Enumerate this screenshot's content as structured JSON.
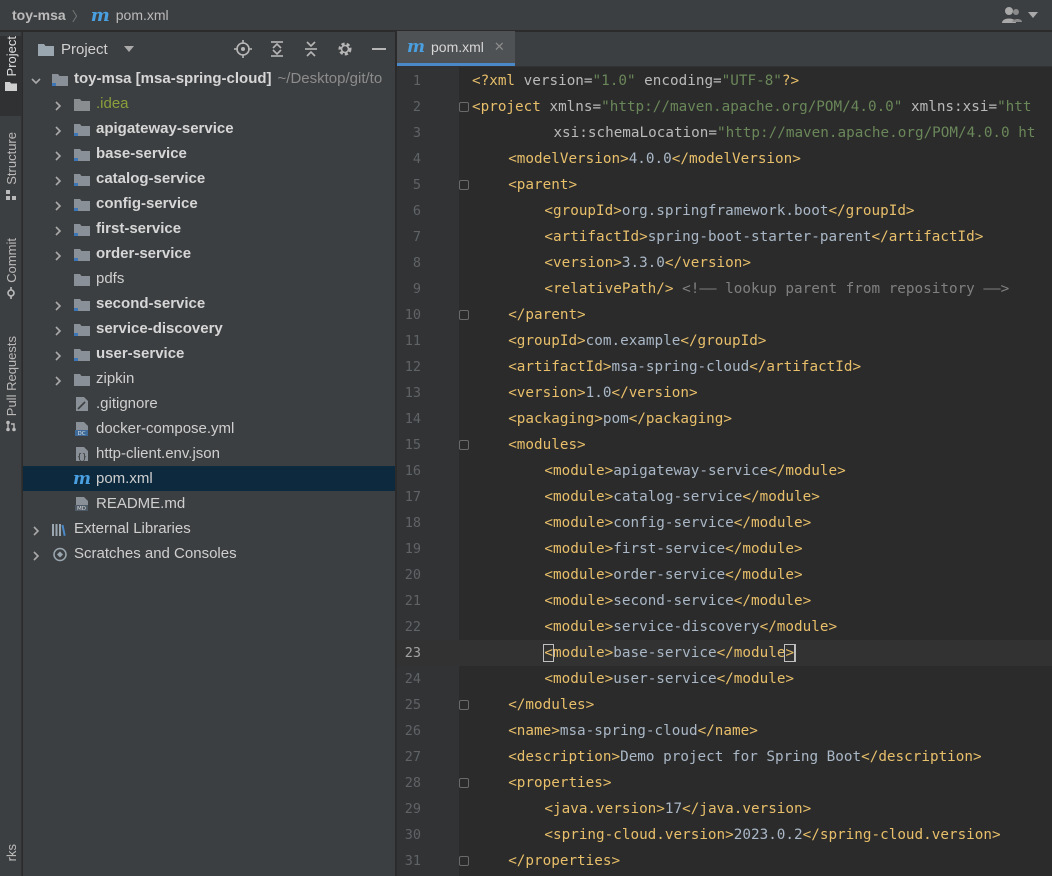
{
  "titlebar": {
    "project": "toy-msa",
    "file_icon": "m",
    "file": "pom.xml"
  },
  "left_strip": {
    "tabs": [
      {
        "label": "Project",
        "active": true
      },
      {
        "label": "Structure"
      },
      {
        "label": "Commit"
      },
      {
        "label": "Pull Requests"
      },
      {
        "label": "rks"
      }
    ]
  },
  "panel": {
    "title": "Project",
    "tree": [
      {
        "label": "toy-msa [msa-spring-cloud]",
        "suffix": "~/Desktop/git/to",
        "type": "module-root",
        "depth": 0,
        "expanded": true,
        "bold": true
      },
      {
        "label": ".idea",
        "type": "folder",
        "depth": 1,
        "idea": true
      },
      {
        "label": "apigateway-service",
        "type": "module",
        "depth": 1,
        "bold": true
      },
      {
        "label": "base-service",
        "type": "module",
        "depth": 1,
        "bold": true
      },
      {
        "label": "catalog-service",
        "type": "module",
        "depth": 1,
        "bold": true
      },
      {
        "label": "config-service",
        "type": "module",
        "depth": 1,
        "bold": true
      },
      {
        "label": "first-service",
        "type": "module",
        "depth": 1,
        "bold": true
      },
      {
        "label": "order-service",
        "type": "module",
        "depth": 1,
        "bold": true
      },
      {
        "label": "pdfs",
        "type": "folder",
        "depth": 1,
        "leaf": true
      },
      {
        "label": "second-service",
        "type": "module",
        "depth": 1,
        "bold": true
      },
      {
        "label": "service-discovery",
        "type": "module",
        "depth": 1,
        "bold": true
      },
      {
        "label": "user-service",
        "type": "module",
        "depth": 1,
        "bold": true
      },
      {
        "label": "zipkin",
        "type": "folder",
        "depth": 1
      },
      {
        "label": ".gitignore",
        "type": "file-ignore",
        "depth": 1,
        "leaf": true
      },
      {
        "label": "docker-compose.yml",
        "type": "file-dc",
        "depth": 1,
        "leaf": true
      },
      {
        "label": "http-client.env.json",
        "type": "file-json",
        "depth": 1,
        "leaf": true
      },
      {
        "label": "pom.xml",
        "type": "file-maven",
        "depth": 1,
        "leaf": true,
        "selected": true
      },
      {
        "label": "README.md",
        "type": "file-md",
        "depth": 1,
        "leaf": true
      },
      {
        "label": "External Libraries",
        "type": "libraries",
        "depth": 0
      },
      {
        "label": "Scratches and Consoles",
        "type": "scratches",
        "depth": 0
      }
    ]
  },
  "editor": {
    "tab_icon": "m",
    "tab_label": "pom.xml",
    "current_line": 23,
    "lines": [
      {
        "n": "1",
        "fold": false,
        "indent": 0,
        "html": "<span class='tag'>&lt;?xml </span><span class='attr'>version=</span><span class='str'>\"1.0\"</span><span class='attr'> encoding=</span><span class='str'>\"UTF-8\"</span><span class='tag'>?&gt;</span>"
      },
      {
        "n": "2",
        "fold": true,
        "indent": 0,
        "html": "<span class='tag'>&lt;project </span><span class='attr'>xmlns=</span><span class='str'>\"http://maven.apache.org/POM/4.0.0\"</span><span class='attr'> xmlns:xsi=</span><span class='str'>\"htt</span>"
      },
      {
        "n": "3",
        "fold": false,
        "indent": 9,
        "html": "<span class='attr'>xsi:schemaLocation=</span><span class='str'>\"http://maven.apache.org/POM/4.0.0 ht</span>"
      },
      {
        "n": "4",
        "fold": false,
        "indent": 4,
        "html": "<span class='tag'>&lt;modelVersion&gt;</span>4.0.0<span class='tag'>&lt;/modelVersion&gt;</span>"
      },
      {
        "n": "5",
        "fold": true,
        "indent": 4,
        "html": "<span class='tag'>&lt;parent&gt;</span>"
      },
      {
        "n": "6",
        "fold": false,
        "indent": 8,
        "html": "<span class='tag'>&lt;groupId&gt;</span>org.springframework.boot<span class='tag'>&lt;/groupId&gt;</span>"
      },
      {
        "n": "7",
        "fold": false,
        "indent": 8,
        "html": "<span class='tag'>&lt;artifactId&gt;</span>spring-boot-starter-parent<span class='tag'>&lt;/artifactId&gt;</span>"
      },
      {
        "n": "8",
        "fold": false,
        "indent": 8,
        "html": "<span class='tag'>&lt;version&gt;</span>3.3.0<span class='tag'>&lt;/version&gt;</span>"
      },
      {
        "n": "9",
        "fold": false,
        "indent": 8,
        "html": "<span class='tag'>&lt;relativePath/&gt;</span> <span class='cmt'>&lt;!—— lookup parent from repository ——&gt;</span>"
      },
      {
        "n": "10",
        "fold": true,
        "indent": 4,
        "html": "<span class='tag'>&lt;/parent&gt;</span>"
      },
      {
        "n": "11",
        "fold": false,
        "indent": 4,
        "html": "<span class='tag'>&lt;groupId&gt;</span>com.example<span class='tag'>&lt;/groupId&gt;</span>"
      },
      {
        "n": "12",
        "fold": false,
        "indent": 4,
        "html": "<span class='tag'>&lt;artifactId&gt;</span>msa-spring-cloud<span class='tag'>&lt;/artifactId&gt;</span>"
      },
      {
        "n": "13",
        "fold": false,
        "indent": 4,
        "html": "<span class='tag'>&lt;version&gt;</span>1.0<span class='tag'>&lt;/version&gt;</span>"
      },
      {
        "n": "14",
        "fold": false,
        "indent": 4,
        "html": "<span class='tag'>&lt;packaging&gt;</span>pom<span class='tag'>&lt;/packaging&gt;</span>"
      },
      {
        "n": "15",
        "fold": true,
        "indent": 4,
        "html": "<span class='tag'>&lt;modules&gt;</span>"
      },
      {
        "n": "16",
        "fold": false,
        "indent": 8,
        "html": "<span class='tag'>&lt;module&gt;</span>apigateway-service<span class='tag'>&lt;/module&gt;</span>"
      },
      {
        "n": "17",
        "fold": false,
        "indent": 8,
        "html": "<span class='tag'>&lt;module&gt;</span>catalog-service<span class='tag'>&lt;/module&gt;</span>"
      },
      {
        "n": "18",
        "fold": false,
        "indent": 8,
        "html": "<span class='tag'>&lt;module&gt;</span>config-service<span class='tag'>&lt;/module&gt;</span>"
      },
      {
        "n": "19",
        "fold": false,
        "indent": 8,
        "html": "<span class='tag'>&lt;module&gt;</span>first-service<span class='tag'>&lt;/module&gt;</span>"
      },
      {
        "n": "20",
        "fold": false,
        "indent": 8,
        "html": "<span class='tag'>&lt;module&gt;</span>order-service<span class='tag'>&lt;/module&gt;</span>"
      },
      {
        "n": "21",
        "fold": false,
        "indent": 8,
        "html": "<span class='tag'>&lt;module&gt;</span>second-service<span class='tag'>&lt;/module&gt;</span>"
      },
      {
        "n": "22",
        "fold": false,
        "indent": 8,
        "html": "<span class='tag'>&lt;module&gt;</span>service-discovery<span class='tag'>&lt;/module&gt;</span>"
      },
      {
        "n": "23",
        "fold": false,
        "indent": 8,
        "html": "<span class='tag'><span class='hl'>&lt;</span>module&gt;</span>base-service<span class='tag'>&lt;/module<span class='hl'>&gt;</span></span><span class='caret'></span>"
      },
      {
        "n": "24",
        "fold": false,
        "indent": 8,
        "html": "<span class='tag'>&lt;module&gt;</span>user-service<span class='tag'>&lt;/module&gt;</span>"
      },
      {
        "n": "25",
        "fold": true,
        "indent": 4,
        "html": "<span class='tag'>&lt;/modules&gt;</span>"
      },
      {
        "n": "26",
        "fold": false,
        "indent": 4,
        "html": "<span class='tag'>&lt;name&gt;</span>msa-spring-cloud<span class='tag'>&lt;/name&gt;</span>"
      },
      {
        "n": "27",
        "fold": false,
        "indent": 4,
        "html": "<span class='tag'>&lt;description&gt;</span>Demo project for Spring Boot<span class='tag'>&lt;/description&gt;</span>"
      },
      {
        "n": "28",
        "fold": true,
        "indent": 4,
        "html": "<span class='tag'>&lt;properties&gt;</span>"
      },
      {
        "n": "29",
        "fold": false,
        "indent": 8,
        "html": "<span class='tag'>&lt;java.version&gt;</span>17<span class='tag'>&lt;/java.version&gt;</span>"
      },
      {
        "n": "30",
        "fold": false,
        "indent": 8,
        "html": "<span class='tag'>&lt;spring-cloud.version&gt;</span>2023.0.2<span class='tag'>&lt;/spring-cloud.version&gt;</span>"
      },
      {
        "n": "31",
        "fold": true,
        "indent": 4,
        "html": "<span class='tag'>&lt;/properties&gt;</span>"
      }
    ]
  }
}
